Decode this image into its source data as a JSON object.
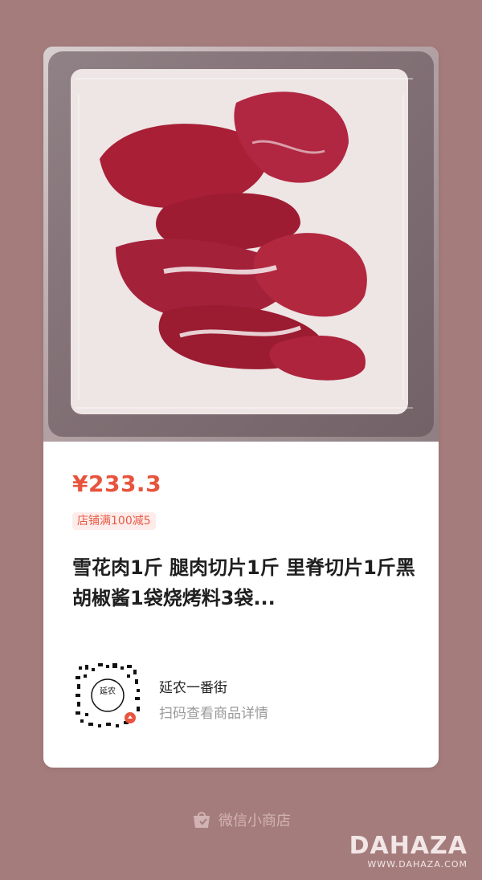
{
  "product": {
    "price": "¥233.3",
    "promo_tag": "店铺满100减5",
    "title": "雪花肉1斤 腿肉切片1斤 里脊切片1斤黑胡椒酱1袋烧烤料3袋..."
  },
  "shop": {
    "name": "延农一番街",
    "scan_hint": "扫码查看商品详情",
    "qr_center_text": "延农"
  },
  "footer": {
    "label": "微信小商店"
  },
  "watermark": {
    "main": "DAHAZA",
    "sub": "WWW.DAHAZA.COM"
  },
  "colors": {
    "background": "#a57c7c",
    "price": "#e7543d",
    "promo_bg": "#fdecea"
  }
}
